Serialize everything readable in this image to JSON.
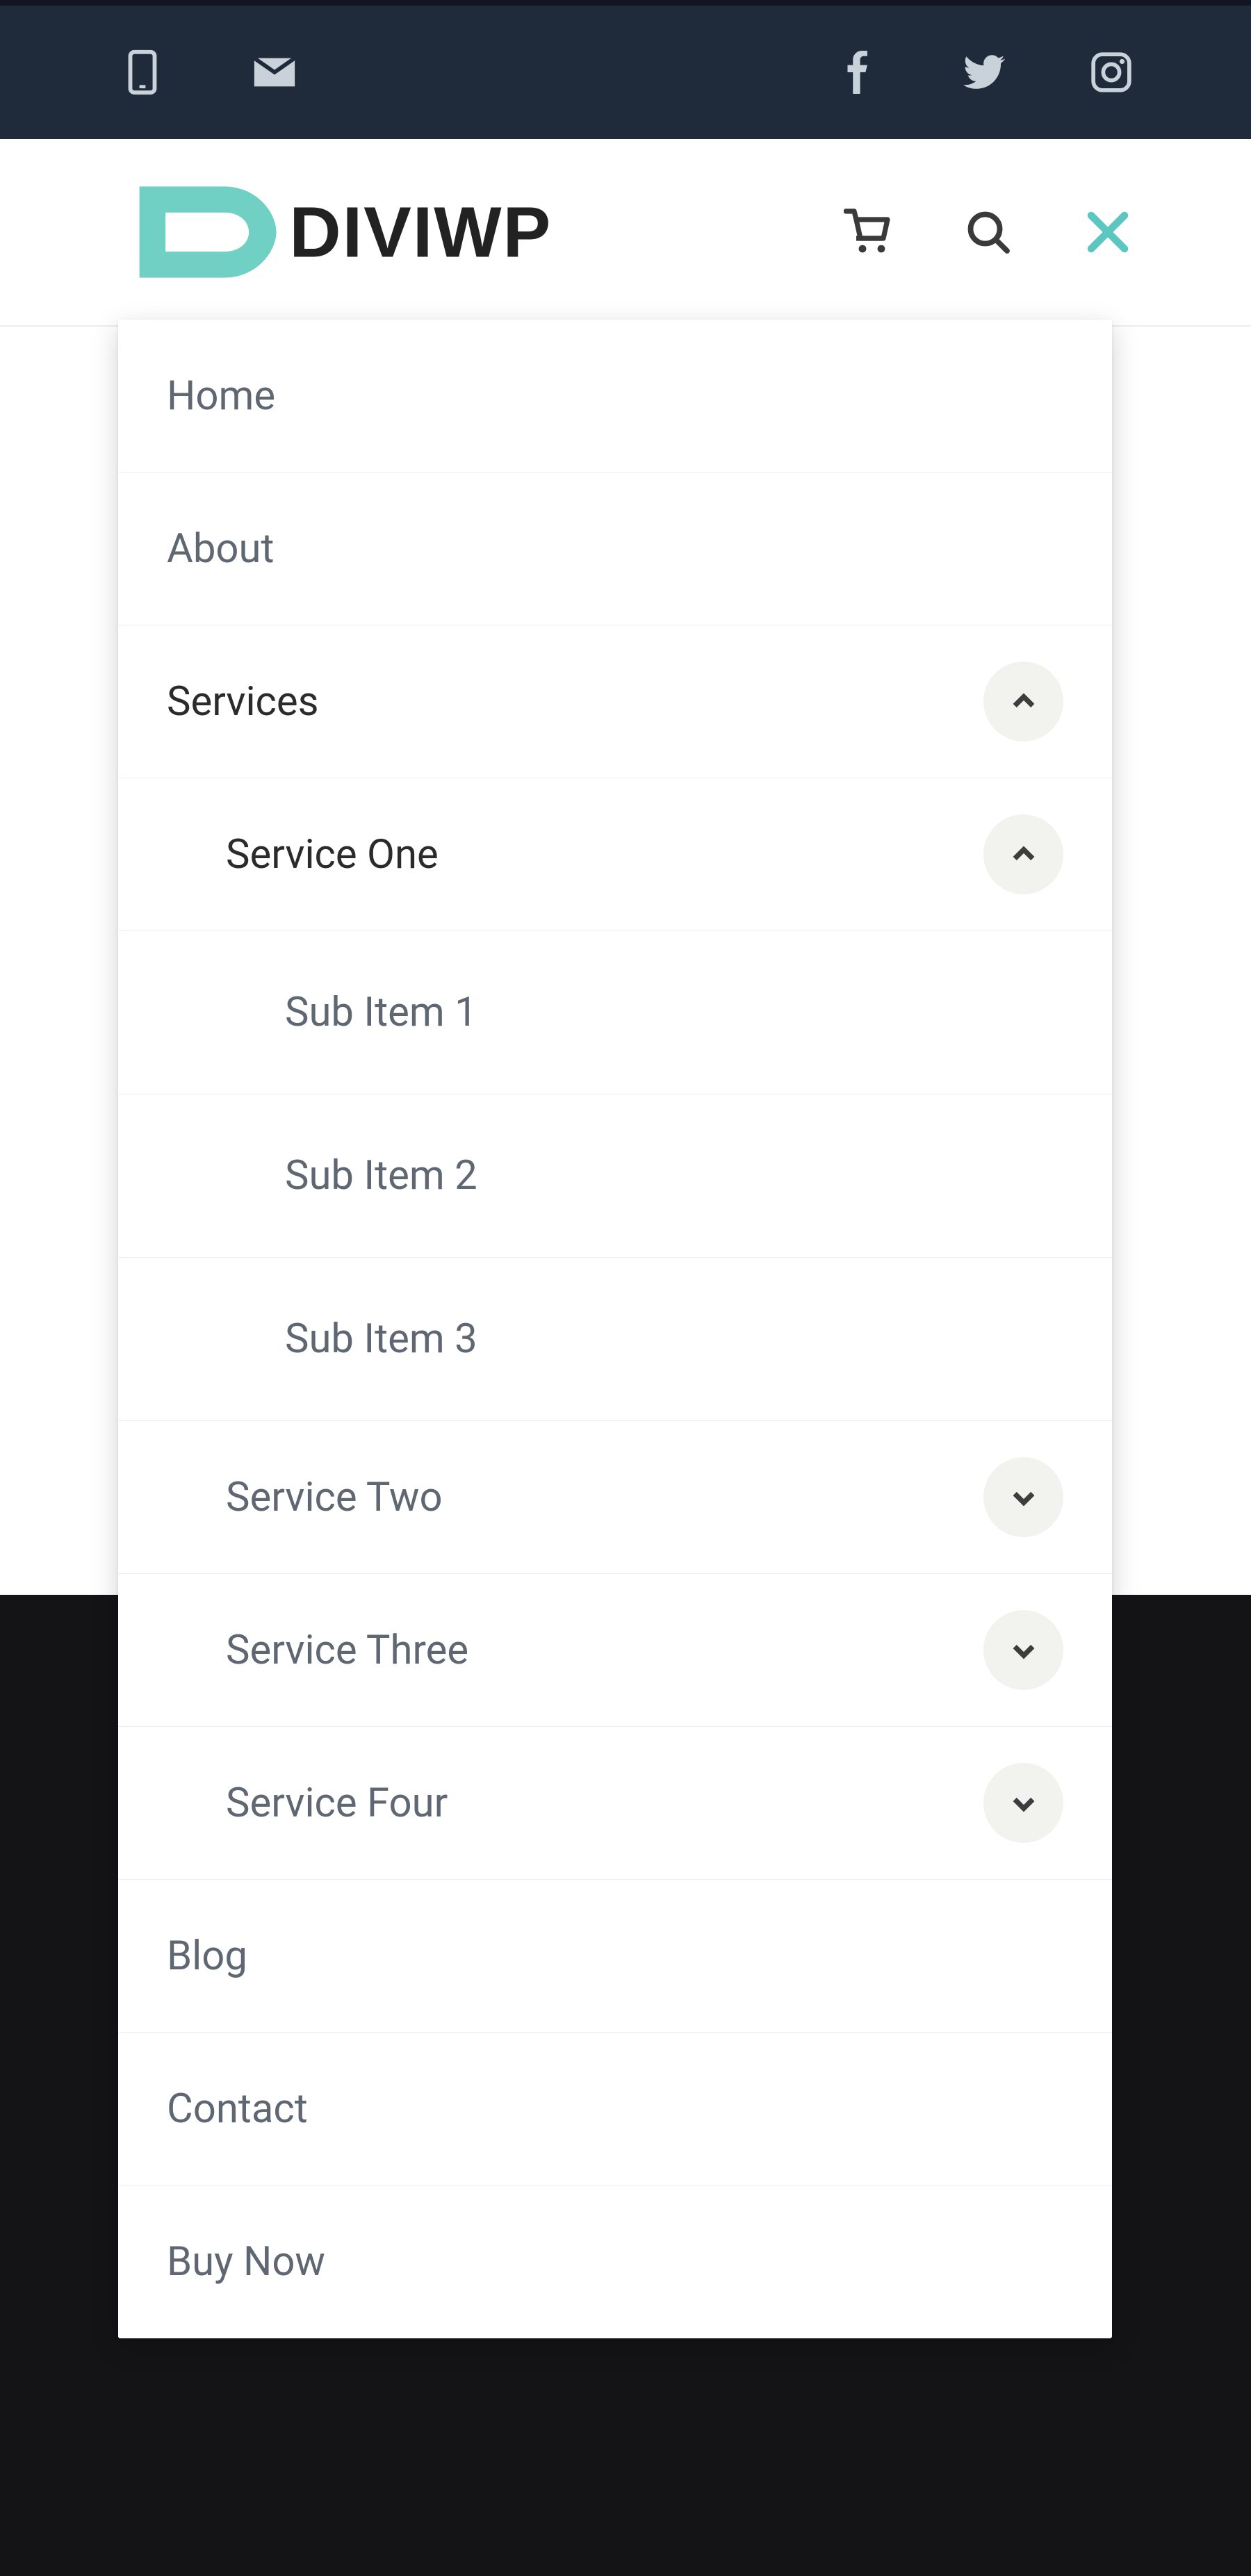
{
  "brand": {
    "name_part1": "DIVI",
    "name_part2": "WP"
  },
  "colors": {
    "accent": "#5bc7c0",
    "topbar": "#1f2b3a",
    "text_muted": "#5e6772",
    "text_active": "#2b2b2b"
  },
  "topbar": {
    "left_icons": [
      "phone-icon",
      "mail-icon"
    ],
    "right_icons": [
      "facebook-icon",
      "twitter-icon",
      "instagram-icon"
    ]
  },
  "header": {
    "actions": [
      "cart-icon",
      "search-icon",
      "close-icon"
    ]
  },
  "menu": {
    "items": [
      {
        "label": "Home"
      },
      {
        "label": "About"
      },
      {
        "label": "Services",
        "expanded": true,
        "children": [
          {
            "label": "Service One",
            "expanded": true,
            "children": [
              {
                "label": "Sub Item 1"
              },
              {
                "label": "Sub Item 2"
              },
              {
                "label": "Sub Item 3"
              }
            ]
          },
          {
            "label": "Service Two",
            "expanded": false
          },
          {
            "label": "Service Three",
            "expanded": false
          },
          {
            "label": "Service Four",
            "expanded": false
          }
        ]
      },
      {
        "label": "Blog"
      },
      {
        "label": "Contact"
      },
      {
        "label": "Buy Now"
      }
    ]
  }
}
